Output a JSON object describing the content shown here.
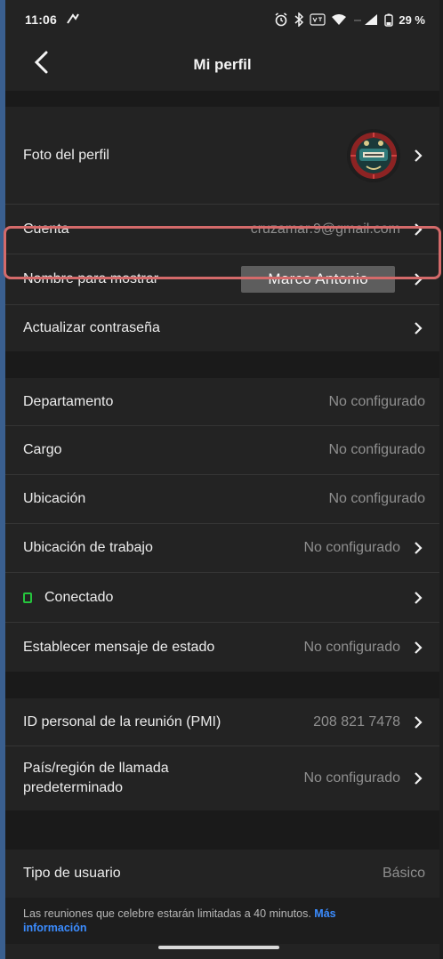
{
  "status_bar": {
    "time": "11:06",
    "battery": "29 %",
    "icons": [
      "alarm-icon",
      "bluetooth-icon",
      "volte-icon",
      "wifi-icon",
      "signal-icon",
      "battery-icon"
    ]
  },
  "header": {
    "title": "Mi perfil",
    "back_icon": "chevron-left-icon"
  },
  "profile": {
    "photo_label": "Foto del perfil",
    "account_label": "Cuenta",
    "account_value": "cruzamar.9@gmail.com",
    "display_name_label": "Nombre para mostrar",
    "display_name_value": "Marco Antonio",
    "password_label": "Actualizar contraseña"
  },
  "details": {
    "department_label": "Departamento",
    "department_value": "No configurado",
    "position_label": "Cargo",
    "position_value": "No configurado",
    "location_label": "Ubicación",
    "location_value": "No configurado",
    "work_location_label": "Ubicación de trabajo",
    "work_location_value": "No configurado",
    "presence_label": "Conectado",
    "status_message_label": "Establecer mensaje de estado",
    "status_message_value": "No configurado"
  },
  "meeting": {
    "pmi_label": "ID personal de la reunión (PMI)",
    "pmi_value": "208 821 7478",
    "country_label_line1": "País/región de llamada",
    "country_label_line2": "predeterminado",
    "country_value": "No configurado"
  },
  "user_type": {
    "label": "Tipo de usuario",
    "value": "Básico"
  },
  "footer": {
    "note": "Las reuniones que celebre estarán limitadas a 40 minutos.",
    "link_line1": "Más",
    "link_line2": "información"
  },
  "colors": {
    "background": "#232323",
    "separator": "#1a1a1a",
    "muted_text": "#8f8f8f",
    "link": "#3b8cff",
    "highlight": "#d46a6a",
    "online": "#25c53d"
  }
}
